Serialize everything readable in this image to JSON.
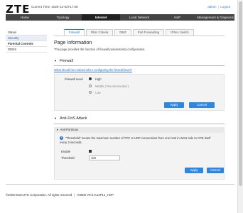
{
  "brand": {
    "logo": "ZTE"
  },
  "header": {
    "current_time": "Current Time: 2025-12-02T17:08",
    "user": "admin",
    "sep": "|",
    "logout": "Logout"
  },
  "nav": {
    "tabs": [
      {
        "label": "Home"
      },
      {
        "label": "Topology"
      },
      {
        "label": "Internet"
      },
      {
        "label": "Local Network"
      },
      {
        "label": "VoIP"
      },
      {
        "label": "Management & Diagnosis"
      }
    ],
    "active_index": 2
  },
  "sidebar": {
    "items": [
      {
        "label": "Status"
      },
      {
        "label": "Security"
      },
      {
        "label": "Parental Controls"
      },
      {
        "label": "DDNS"
      }
    ]
  },
  "subtabs": [
    {
      "label": "Firewall"
    },
    {
      "label": "Filter Criteria"
    },
    {
      "label": "DMZ"
    },
    {
      "label": "Port Forwarding"
    },
    {
      "label": "IPSec Switch"
    }
  ],
  "page": {
    "title": "Page Information",
    "description": "This page provides the function of firewall parameter(s) configuration."
  },
  "firewall": {
    "section_title": "Firewall",
    "help_link": "What should be noticed when configuring the firewall level?",
    "level_label": "Firewall Level",
    "options": [
      "High",
      "Middle ( Recommended )",
      "Low"
    ],
    "selected": "High",
    "apply": "Apply",
    "cancel": "Cancel"
  },
  "dos": {
    "section_title": "Anti-DoS Attack",
    "sub_title": "Anti-PortScan",
    "note": "\"Threshold\" means the maximum number of TCP or UDP connections from one host in WAN side to CPE itself every 3 seconds.",
    "enable_label": "Enable",
    "enable_checked": true,
    "threshold_label": "Threshold",
    "threshold_value": "100",
    "apply": "Apply",
    "cancel": "Cancel"
  },
  "footer": {
    "copyright": "©2008-2024 ZTE Corporation. All rights reserved",
    "sep": "|",
    "version": "H3600 V9.0.0.24P14_HOP"
  },
  "colors": {
    "accent": "#2f86e0",
    "nav_bg": "#444444",
    "nav_active": "#222222"
  }
}
